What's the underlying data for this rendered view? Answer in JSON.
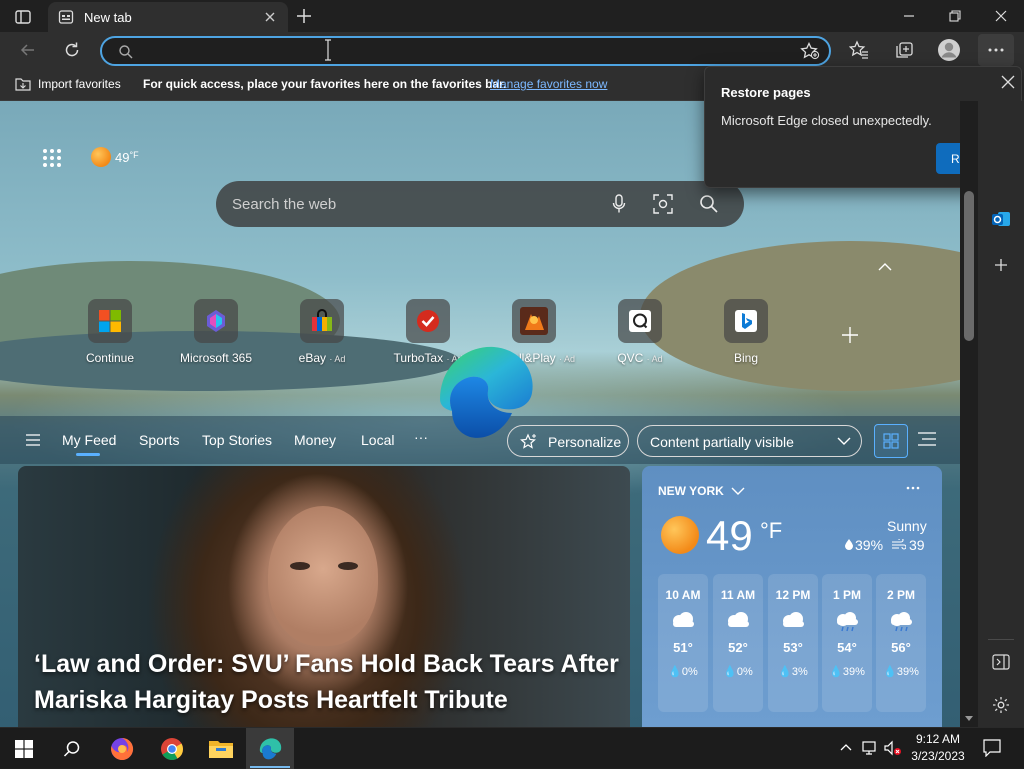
{
  "tab": {
    "title": "New tab"
  },
  "address": {
    "value": "",
    "placeholder": ""
  },
  "favorites_bar": {
    "import_label": "Import favorites",
    "hint": "For quick access, place your favorites here on the favorites bar.",
    "manage_link": "Manage favorites now"
  },
  "restore_popup": {
    "title": "Restore pages",
    "message": "Microsoft Edge closed unexpectedly.",
    "button": "Restore"
  },
  "ntp": {
    "weather_mini": "49",
    "weather_mini_unit": "°F",
    "search_placeholder": "Search the web",
    "tiles": [
      {
        "label": "Continue",
        "ad": ""
      },
      {
        "label": "Microsoft 365",
        "ad": ""
      },
      {
        "label": "eBay",
        "ad": "· Ad"
      },
      {
        "label": "TurboTax",
        "ad": "· Ad"
      },
      {
        "label": "Install&Play",
        "ad": "· Ad"
      },
      {
        "label": "QVC",
        "ad": "· Ad"
      },
      {
        "label": "Bing",
        "ad": ""
      }
    ],
    "feed_nav": [
      "My Feed",
      "Sports",
      "Top Stories",
      "Money",
      "Local",
      "···"
    ],
    "personalize": "Personalize",
    "content_visibility": "Content partially visible",
    "hero_headline": "‘Law and Order: SVU’ Fans Hold Back Tears After Mariska Hargitay Posts Heartfelt Tribute"
  },
  "weather": {
    "location": "NEW YORK",
    "temp": "49",
    "unit": "°F",
    "condition": "Sunny",
    "precip": "39%",
    "wind": "39",
    "hourly": [
      {
        "time": "10 AM",
        "temp": "51°",
        "precip": "0%",
        "icon": "cloud-sun-icon"
      },
      {
        "time": "11 AM",
        "temp": "52°",
        "precip": "0%",
        "icon": "cloud-sun-icon"
      },
      {
        "time": "12 PM",
        "temp": "53°",
        "precip": "3%",
        "icon": "cloud-sun-icon"
      },
      {
        "time": "1 PM",
        "temp": "54°",
        "precip": "39%",
        "icon": "cloud-rain-icon"
      },
      {
        "time": "2 PM",
        "temp": "56°",
        "precip": "39%",
        "icon": "cloud-rain-icon"
      }
    ]
  },
  "taskbar": {
    "time": "9:12 AM",
    "date": "3/23/2023"
  },
  "colors": {
    "accent": "#0f6cbd",
    "address_focus": "#4ea4e2",
    "link": "#7cb8ff"
  }
}
